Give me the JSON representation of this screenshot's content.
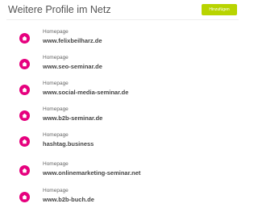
{
  "header": {
    "title": "Weitere Profile im Netz",
    "add_label": "Hinzufügen"
  },
  "profiles": [
    {
      "label": "Homepage",
      "value": "www.felixbeilharz.de",
      "icon": "home-icon"
    },
    {
      "label": "Homepage",
      "value": "www.seo-seminar.de",
      "icon": "home-icon"
    },
    {
      "label": "Homepage",
      "value": "www.social-media-seminar.de",
      "icon": "home-icon"
    },
    {
      "label": "Homepage",
      "value": "www.b2b-seminar.de",
      "icon": "home-icon"
    },
    {
      "label": "Homepage",
      "value": "hashtag.business",
      "icon": "home-icon"
    },
    {
      "label": "Homepage",
      "value": "www.onlinemarketing-seminar.net",
      "icon": "home-icon"
    },
    {
      "label": "Homepage",
      "value": "www.b2b-buch.de",
      "icon": "home-icon"
    }
  ],
  "colors": {
    "accent": "#e6007e",
    "button": "#b8d400"
  }
}
